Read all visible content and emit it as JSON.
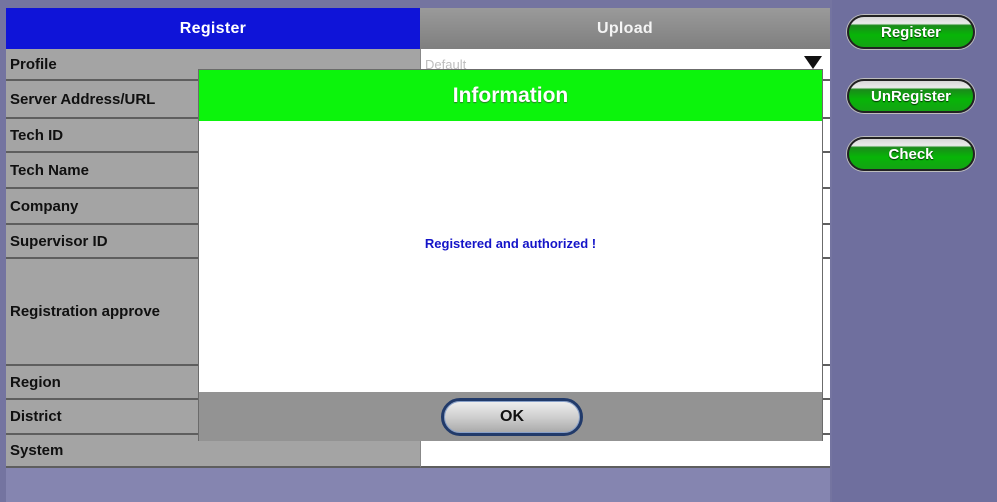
{
  "tabs": {
    "register": "Register",
    "upload": "Upload"
  },
  "form": {
    "profile_label": "Profile",
    "profile_value": "Default",
    "server_label": "Server Address/URL",
    "tech_id_label": "Tech ID",
    "tech_name_label": "Tech Name",
    "company_label": "Company",
    "supervisor_label": "Supervisor ID",
    "approval_label": "Registration approve",
    "region_label": "Region",
    "district_label": "District",
    "system_label": "System"
  },
  "side_buttons": {
    "register": "Register",
    "unregister": "UnRegister",
    "check": "Check"
  },
  "dialog": {
    "title": "Information",
    "message": "Registered and authorized !",
    "ok": "OK"
  },
  "colors": {
    "active_tab": "#0f14d8",
    "dialog_header": "#0cf40c",
    "message_text": "#1414c8",
    "button_green": "#07b507"
  },
  "icons": {
    "profile_dropdown": "chevron-down-icon"
  }
}
